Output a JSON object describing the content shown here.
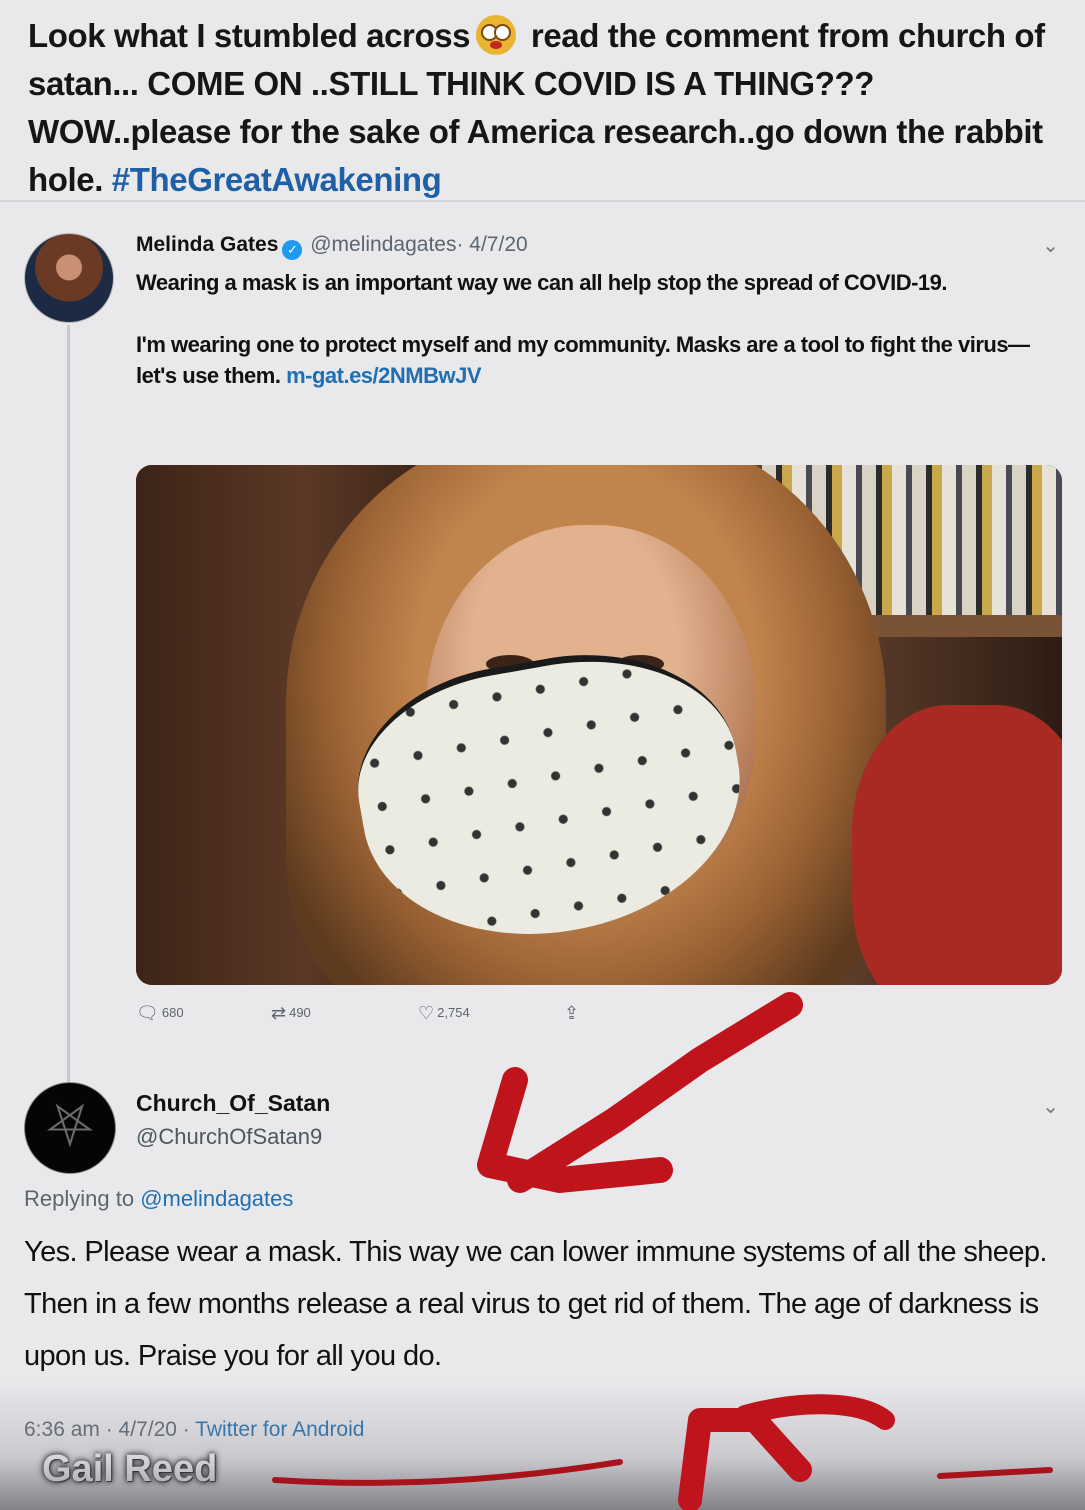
{
  "caption": {
    "text_before_emoji": "Look what I stumbled across",
    "emoji": "flushed-face-emoji",
    "text_after_emoji": " read the comment from church of satan... COME ON ..STILL THINK COVID IS A THING??? WOW..please for the sake of America research..go down the rabbit hole. ",
    "hashtag": "#TheGreatAwakening"
  },
  "tweet1": {
    "name": "Melinda Gates",
    "handle": "@melindagates",
    "date": "· 4/7/20",
    "paragraph1": "Wearing a mask is an important way we can all help stop the spread of COVID-19.",
    "paragraph2": "I'm wearing one to protect myself and my community. Masks are a tool to fight the virus—let's use them. ",
    "link": "m-gat.es/2NMBwJV",
    "replies": "680",
    "retweets": "490",
    "likes": "2,754",
    "photo_subject": "selfie of woman wearing heart-pattern face mask in front of bookshelf"
  },
  "tweet2": {
    "name": "Church_Of_Satan",
    "handle": "@ChurchOfSatan9",
    "replying_label": "Replying to ",
    "replying_to": "@melindagates",
    "text": "Yes. Please wear a mask. This way we can lower immune systems of all the sheep. Then in a few months release a real virus to get rid of them. The age of darkness is upon us. Praise you for all you do.",
    "time": "6:36 am · 4/7/20 · ",
    "app": "Twitter for Android"
  },
  "watermark": "Gail Reed",
  "colors": {
    "background": "#e9e9ec",
    "link": "#1f6fb2",
    "hashtag": "#1f5fa6",
    "annotation_red": "#c0141c",
    "verified": "#1d9bf0"
  },
  "icons": [
    "verified-icon",
    "reply-icon",
    "retweet-icon",
    "like-icon",
    "share-icon",
    "chevron-down-icon",
    "pentagram-icon"
  ]
}
